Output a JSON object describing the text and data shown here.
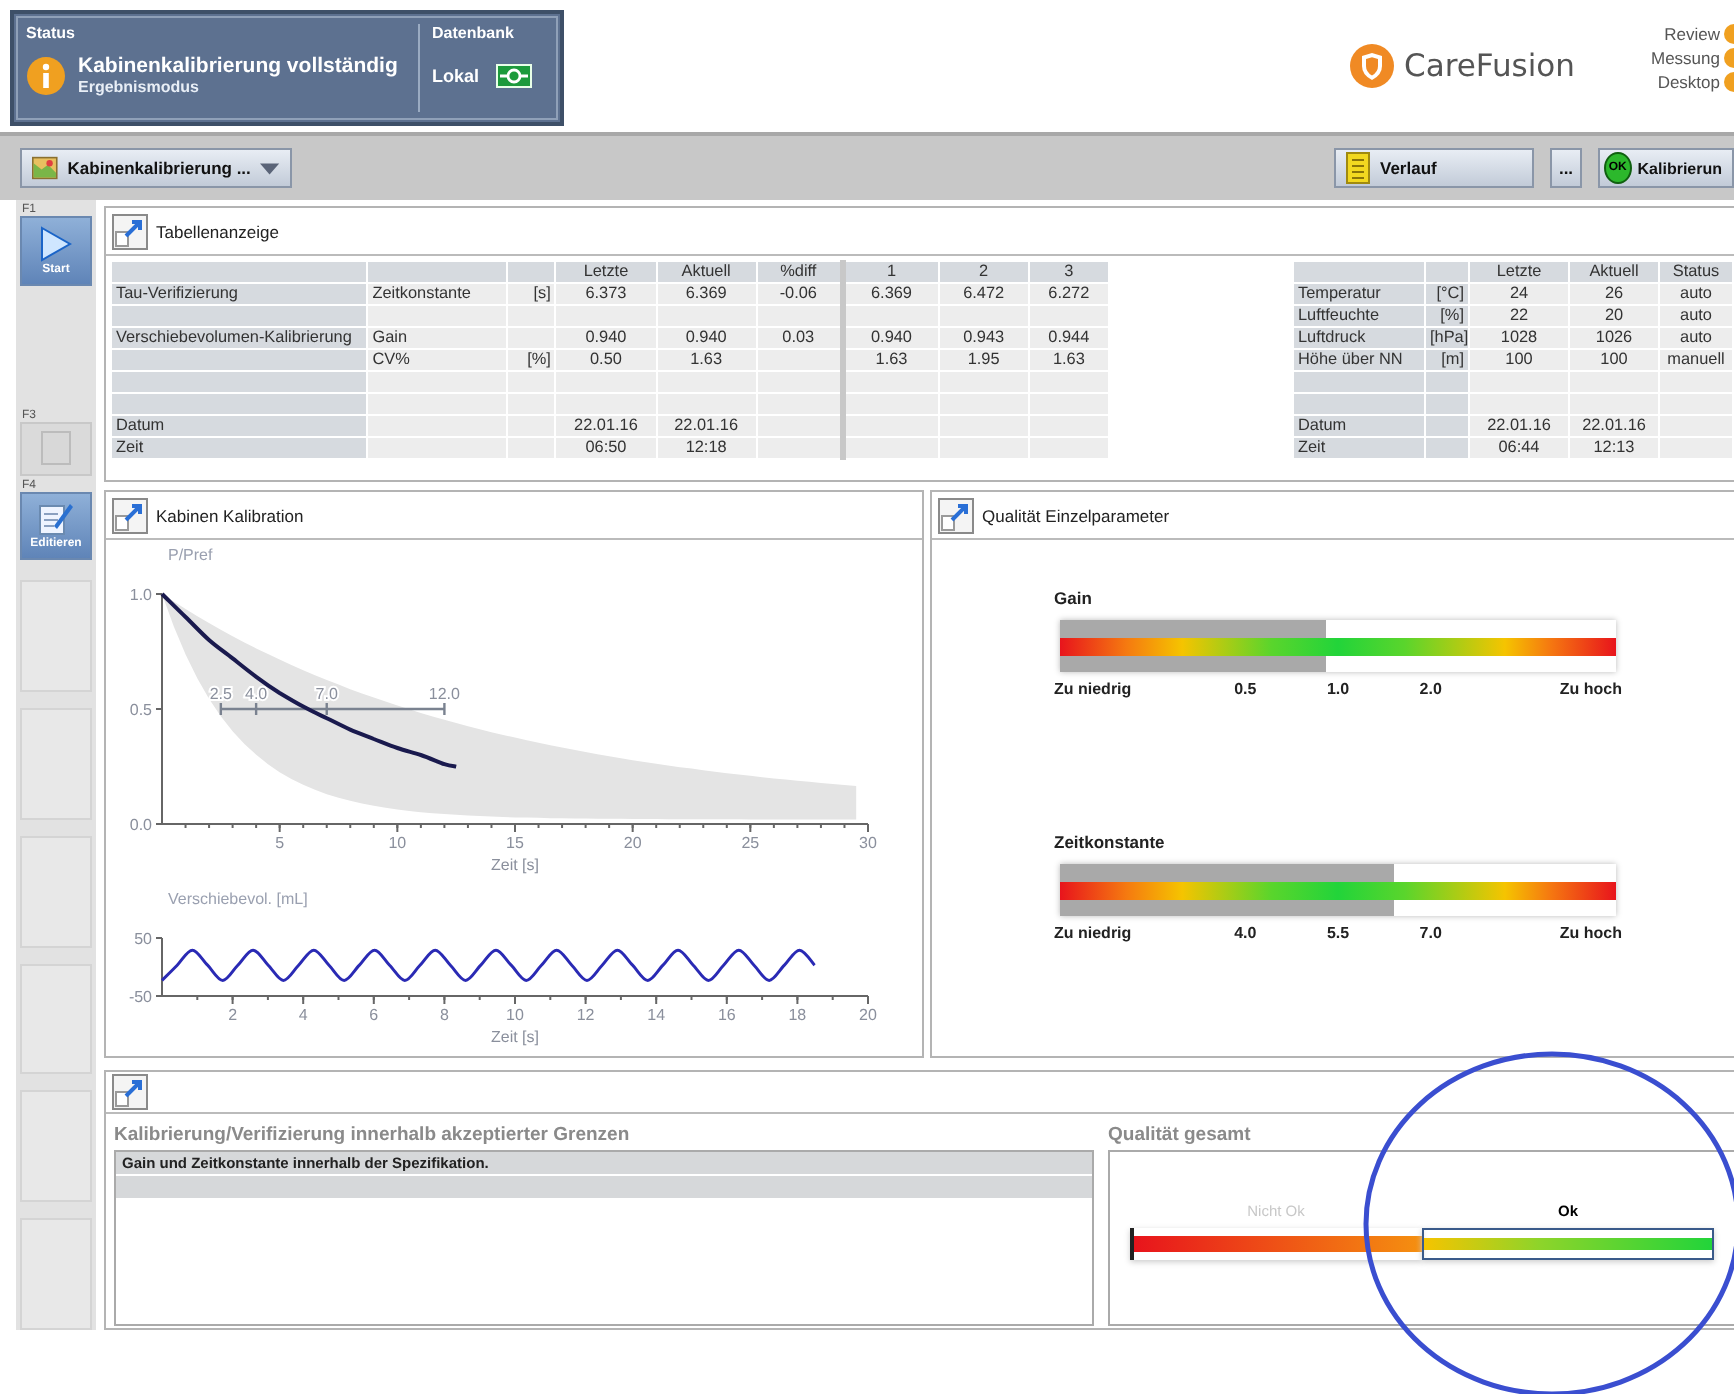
{
  "status_panel": {
    "heading": "Status",
    "message": "Kabinenkalibrierung vollständig",
    "mode": "Ergebnismodus",
    "db_heading": "Datenbank",
    "db_value": "Lokal"
  },
  "brand": {
    "name": "CareFusion"
  },
  "mode_links": [
    {
      "label": "Review"
    },
    {
      "label": "Messung"
    },
    {
      "label": "Desktop"
    }
  ],
  "toolbar": {
    "procedure": "Kabinenkalibrierung ...",
    "history": "Verlauf",
    "more": "...",
    "calibrate_badge": "OK",
    "calibrate": "Kalibrierun"
  },
  "sidebar": [
    {
      "key": "F1",
      "label": "Start",
      "kind": "start",
      "disabled": false
    },
    {
      "key": "F3",
      "kind": "print",
      "disabled": true
    },
    {
      "key": "F4",
      "label": "Editieren",
      "kind": "edit",
      "disabled": false
    }
  ],
  "table_panel": {
    "title": "Tabellenanzeige",
    "main_table": {
      "columns": {
        "letzte": "Letzte",
        "aktuell": "Aktuell",
        "diff": "%diff",
        "run_1": "1",
        "run_2": "2",
        "run_3": "3"
      },
      "rows": [
        {
          "name": "Tau-Verifizierung",
          "parameter": "Zeitkonstante",
          "unit": "[s]",
          "letzte": "6.373",
          "aktuell": "6.369",
          "diff": "-0.06",
          "run_1": "6.369",
          "run_2": "6.472",
          "run_3": "6.272"
        },
        {},
        {
          "name": "Verschiebevolumen-Kalibrierung",
          "parameter": "Gain",
          "letzte": "0.940",
          "aktuell": "0.940",
          "diff": "0.03",
          "run_1": "0.940",
          "run_2": "0.943",
          "run_3": "0.944"
        },
        {
          "parameter": "CV%",
          "unit": "[%]",
          "letzte": "0.50",
          "aktuell": "1.63",
          "run_1": "1.63",
          "run_2": "1.95",
          "run_3": "1.63"
        },
        {},
        {},
        {
          "name": "Datum",
          "letzte": "22.01.16",
          "aktuell": "22.01.16"
        },
        {
          "name": "Zeit",
          "letzte": "06:50",
          "aktuell": "12:18"
        }
      ]
    },
    "ambient_table": {
      "columns": {
        "letzte": "Letzte",
        "aktuell": "Aktuell",
        "status": "Status"
      },
      "rows": [
        {
          "name": "Temperatur",
          "unit": "[°C]",
          "letzte": "24",
          "aktuell": "26",
          "status": "auto"
        },
        {
          "name": "Luftfeuchte",
          "unit": "[%]",
          "letzte": "22",
          "aktuell": "20",
          "status": "auto"
        },
        {
          "name": "Luftdruck",
          "unit": "[hPa]",
          "letzte": "1028",
          "aktuell": "1026",
          "status": "auto"
        },
        {
          "name": "Höhe über NN",
          "unit": "[m]",
          "letzte": "100",
          "aktuell": "100",
          "status": "manuell"
        },
        {},
        {},
        {
          "name": "Datum",
          "letzte": "22.01.16",
          "aktuell": "22.01.16"
        },
        {
          "name": "Zeit",
          "letzte": "06:44",
          "aktuell": "12:13"
        }
      ]
    }
  },
  "charts_panel": {
    "title": "Kabinen Kalibration",
    "pressure_chart": {
      "chart_data": {
        "type": "line",
        "xlabel": "Zeit [s]",
        "ylabel": "P/Pref",
        "xlim": [
          0,
          30
        ],
        "ylim": [
          0,
          1
        ],
        "xticks": [
          5,
          10,
          15,
          20,
          25,
          30
        ],
        "yticks": [
          {
            "value": 0,
            "label": "0.0"
          },
          {
            "value": 0.5,
            "label": "0.5"
          },
          {
            "value": 1,
            "label": "1.0"
          }
        ],
        "x": [
          0,
          1,
          2,
          3,
          4,
          5,
          6,
          7,
          8,
          9,
          10,
          11,
          12,
          12.5
        ],
        "series": [
          {
            "color": "#1a1a4e",
            "values": [
              1,
              0.9,
              0.8,
              0.72,
              0.64,
              0.57,
              0.51,
              0.46,
              0.41,
              0.37,
              0.33,
              0.3,
              0.26,
              0.25
            ]
          }
        ],
        "annotations": [
          "2.5",
          "4.0",
          "7.0",
          "12.0"
        ]
      }
    },
    "volume_chart": {
      "chart_data": {
        "type": "line",
        "xlabel": "Zeit [s]",
        "ylabel": "Verschiebevol. [mL]",
        "xlim": [
          0,
          20
        ],
        "ylim": [
          -50,
          50
        ],
        "xticks": [
          2,
          4,
          6,
          8,
          10,
          12,
          14,
          16,
          18,
          20
        ],
        "yticks": [
          -50,
          50
        ],
        "x": [
          0,
          0.43,
          0.86,
          1.29,
          1.72,
          2.15,
          2.58,
          3.01,
          3.44,
          3.87,
          4.3,
          4.73,
          5.16,
          5.59,
          6.02,
          6.45,
          6.88,
          7.31,
          7.74,
          8.17,
          8.6,
          9.03,
          9.46,
          9.89,
          10.32,
          10.75,
          11.18,
          11.61,
          12.04,
          12.47,
          12.9,
          13.33,
          13.76,
          14.19,
          14.62,
          15.05,
          15.48,
          15.91,
          16.34,
          16.77,
          17.2,
          17.63,
          18.06,
          18.49
        ],
        "series": [
          {
            "color": "#2a2ab4",
            "values": [
              -23,
              3,
              29,
              3,
              -23,
              3,
              29,
              3,
              -23,
              3,
              29,
              3,
              -23,
              3,
              29,
              3,
              -23,
              3,
              29,
              3,
              -23,
              3,
              29,
              3,
              -23,
              3,
              29,
              3,
              -23,
              3,
              29,
              3,
              -23,
              3,
              29,
              3,
              -23,
              3,
              29,
              3,
              -23,
              3,
              29,
              3
            ]
          }
        ]
      }
    }
  },
  "quality_panel": {
    "title": "Qualität Einzelparameter",
    "gauges": [
      {
        "label": "Gain",
        "level": 0.48,
        "low": "Zu niedrig",
        "ticks": [
          "0.5",
          "1.0",
          "2.0"
        ],
        "high": "Zu hoch"
      },
      {
        "label": "Zeitkonstante",
        "level": 0.6,
        "low": "Zu niedrig",
        "ticks": [
          "4.0",
          "5.5",
          "7.0"
        ],
        "high": "Zu hoch"
      }
    ]
  },
  "result_panel": {
    "message_heading": "Kalibrierung/Verifizierung innerhalb akzeptierter Grenzen",
    "messages": [
      {
        "text": "Gain und Zeitkonstante innerhalb der Spezifikation."
      }
    ],
    "quality_heading": "Qualität gesamt",
    "quality_segments": [
      {
        "label": "Nicht Ok",
        "kind": "bad",
        "selected": false
      },
      {
        "label": "Ok",
        "kind": "good",
        "selected": true
      }
    ]
  }
}
